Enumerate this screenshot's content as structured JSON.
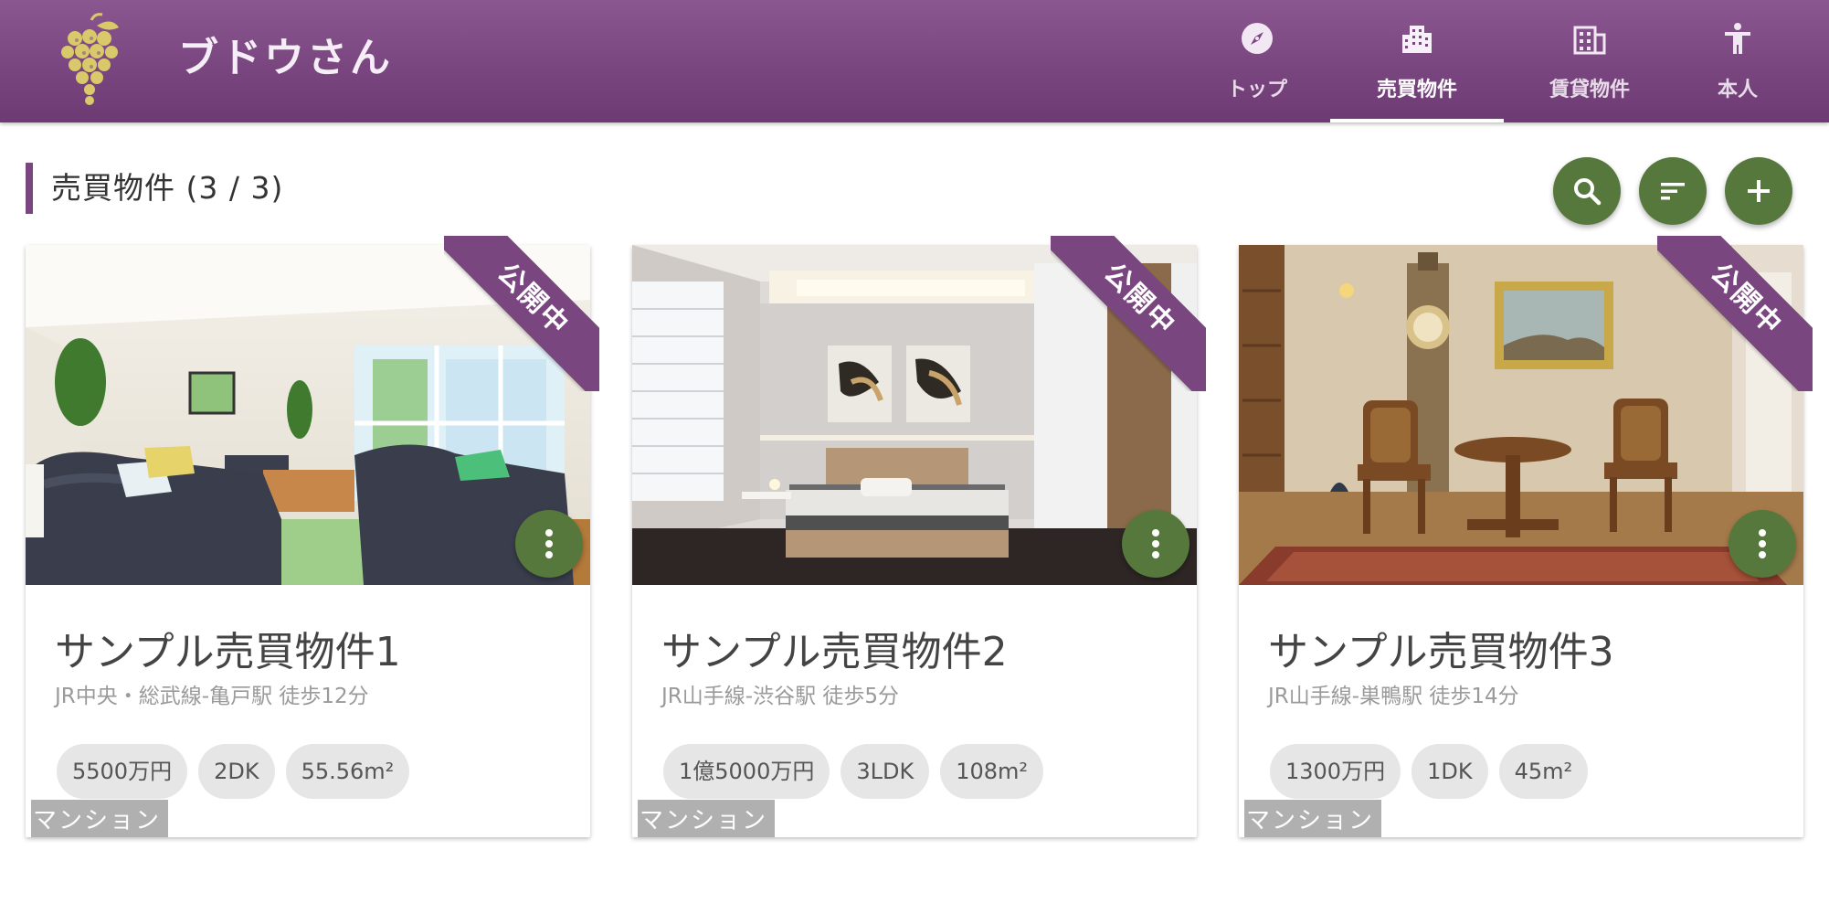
{
  "app": {
    "title": "ブドウさん",
    "logo_icon": "grape-logo-icon",
    "brand_color": "#7a4680",
    "accent_color": "#56783c"
  },
  "nav": {
    "tabs": [
      {
        "label": "トップ",
        "icon": "compass-icon",
        "active": false
      },
      {
        "label": "売買物件",
        "icon": "building-icon",
        "active": true
      },
      {
        "label": "賃貸物件",
        "icon": "apartment-icon",
        "active": false
      },
      {
        "label": "本人",
        "icon": "person-icon",
        "active": false
      }
    ]
  },
  "section": {
    "title": "売買物件 (3 / 3)",
    "actions": [
      {
        "name": "search",
        "icon": "search-icon"
      },
      {
        "name": "sort",
        "icon": "sort-icon"
      },
      {
        "name": "add",
        "icon": "plus-icon"
      }
    ]
  },
  "cards": [
    {
      "status": "公開中",
      "type": "マンション",
      "title": "サンプル売買物件1",
      "access": "JR中央・総武線-亀戸駅 徒歩12分",
      "price": "5500万円",
      "layout": "2DK",
      "area": "55.56m²",
      "photo": "living-room-photo"
    },
    {
      "status": "公開中",
      "type": "マンション",
      "title": "サンプル売買物件2",
      "access": "JR山手線-渋谷駅 徒歩5分",
      "price": "1億5000万円",
      "layout": "3LDK",
      "area": "108m²",
      "photo": "bedroom-photo"
    },
    {
      "status": "公開中",
      "type": "マンション",
      "title": "サンプル売買物件3",
      "access": "JR山手線-巣鴨駅 徒歩14分",
      "price": "1300万円",
      "layout": "1DK",
      "area": "45m²",
      "photo": "dining-room-photo"
    }
  ]
}
